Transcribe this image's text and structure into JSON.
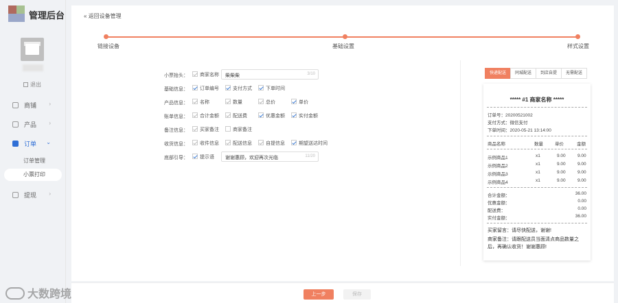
{
  "app": {
    "title": "管理后台"
  },
  "sidebar": {
    "logout": "退出",
    "items": [
      {
        "label": "商铺",
        "icon": "shop-icon"
      },
      {
        "label": "产品",
        "icon": "product-icon"
      },
      {
        "label": "订单",
        "icon": "order-icon"
      },
      {
        "label": "提现",
        "icon": "withdraw-icon"
      }
    ],
    "sub_items": [
      "订单管理",
      "小票打印"
    ]
  },
  "header": {
    "back": "返回设备管理"
  },
  "steps": [
    "链接设备",
    "基础设置",
    "样式设置"
  ],
  "form": {
    "rows": [
      {
        "label": "小票抬头：",
        "options": [
          {
            "text": "商家名称",
            "checked": true,
            "disabled": true
          }
        ],
        "input": {
          "value": "柴柴柴",
          "count": "3/10"
        }
      },
      {
        "label": "基础信息：",
        "options": [
          {
            "text": "订单编号",
            "checked": true
          },
          {
            "text": "支付方式",
            "checked": true
          },
          {
            "text": "下单时间",
            "checked": true
          }
        ]
      },
      {
        "label": "产品信息：",
        "options": [
          {
            "text": "名称",
            "checked": true,
            "disabled": true
          },
          {
            "text": "数量",
            "checked": true,
            "disabled": true
          },
          {
            "text": "总价",
            "checked": true,
            "disabled": true
          },
          {
            "text": "单价",
            "checked": true
          }
        ]
      },
      {
        "label": "账单信息：",
        "options": [
          {
            "text": "合计金额",
            "checked": true,
            "disabled": true
          },
          {
            "text": "配送费",
            "checked": true,
            "disabled": true
          },
          {
            "text": "优惠金额",
            "checked": true
          },
          {
            "text": "实付金额",
            "checked": true
          }
        ]
      },
      {
        "label": "备注信息：",
        "options": [
          {
            "text": "买家备注",
            "checked": true,
            "disabled": true
          },
          {
            "text": "商家备注",
            "checked": false
          }
        ]
      },
      {
        "label": "收货信息：",
        "options": [
          {
            "text": "收件信息",
            "checked": true,
            "disabled": true
          },
          {
            "text": "配送信息",
            "checked": true,
            "disabled": true
          },
          {
            "text": "自提信息",
            "checked": true,
            "disabled": true
          },
          {
            "text": "期望送达时间",
            "checked": true
          }
        ]
      },
      {
        "label": "底部引导：",
        "options": [
          {
            "text": "提示语",
            "checked": true
          }
        ],
        "input": {
          "value": "谢谢惠顾，欢迎再次光临",
          "count": "11/20"
        }
      }
    ]
  },
  "preview": {
    "tabs": [
      "快递配送",
      "同城配送",
      "到店自提",
      "无需配送"
    ],
    "receipt": {
      "title": "***** #1  商家名称 *****",
      "order_no": "订单号：20200521002",
      "pay_method": "支付方式：微信支付",
      "order_time": "下单时间：2020-05-21 13:14:00",
      "headers": [
        "商品名称",
        "数量",
        "单价",
        "金额"
      ],
      "items": [
        [
          "示例商品1",
          "x1",
          "9.00",
          "9.00"
        ],
        [
          "示例商品2",
          "x1",
          "9.00",
          "9.00"
        ],
        [
          "示例商品3",
          "x1",
          "9.00",
          "9.00"
        ],
        [
          "示例商品4",
          "x1",
          "9.00",
          "9.00"
        ]
      ],
      "totals": [
        [
          "合计金额：",
          "36.00"
        ],
        [
          "优惠金额：",
          "0.00"
        ],
        [
          "配送费：",
          "0.00"
        ],
        [
          "实付金额：",
          "36.00"
        ]
      ],
      "buyer_msg": "买家留言：请尽快配送，谢谢!",
      "seller_note": "商家备注：请跟配送员当面清点商品数量之后，再确认收货！谢谢惠顾!"
    }
  },
  "footer": {
    "prev": "上一步",
    "save": "保存"
  },
  "watermark": "大数跨境",
  "colors": {
    "accent": "#f08060",
    "link": "#2f6fd6"
  }
}
